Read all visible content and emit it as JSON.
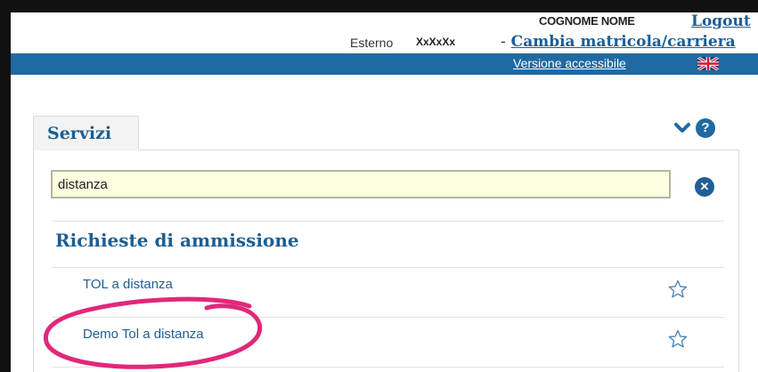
{
  "header": {
    "user_name": "COGNOME NOME",
    "logout": "Logout",
    "esterno_label": "Esterno",
    "esterno_code": "XxXxXx",
    "cambia_dash": "-",
    "cambia_link": "Cambia matricola/carriera",
    "accessibile": "Versione accessibile",
    "flag_icon": "uk-flag-icon"
  },
  "colors": {
    "bluebar": "#1f6aa3",
    "link": "#1d5e93",
    "search_bg": "#fdfde0",
    "annotation": "#e0287a"
  },
  "services": {
    "tab_label": "Servizi",
    "collapse_icon": "chevron-down-icon",
    "help_icon": "help-icon",
    "help_symbol": "?",
    "search_value": "distanza",
    "clear_icon": "clear-icon",
    "clear_symbol": "✕",
    "section_title": "Richieste di ammissione",
    "items": [
      {
        "label": "TOL a distanza",
        "icon": "star-outline-icon"
      },
      {
        "label": "Demo Tol a distanza",
        "icon": "star-outline-icon"
      }
    ]
  }
}
